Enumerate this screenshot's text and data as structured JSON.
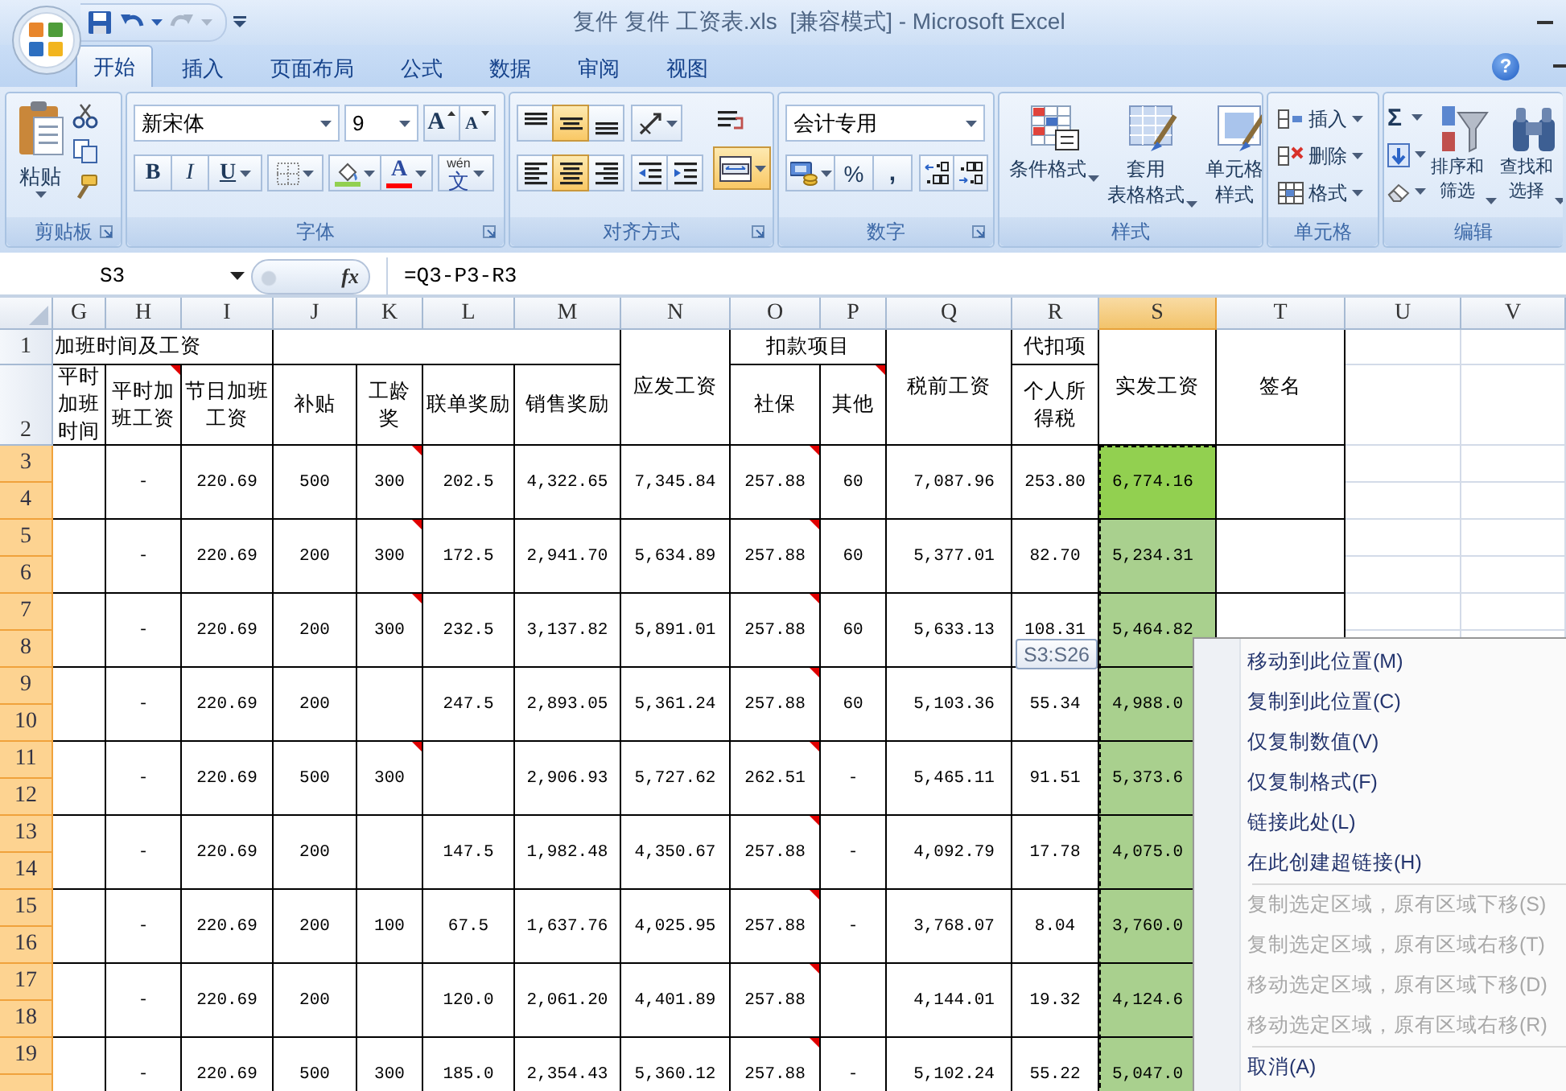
{
  "title_bar": {
    "title": "复件 复件 工资表.xls  [兼容模式] - Microsoft Excel",
    "quick_access": [
      {
        "kind": "save",
        "disabled": false
      },
      {
        "kind": "undo",
        "disabled": false
      },
      {
        "kind": "redo",
        "disabled": true
      }
    ]
  },
  "tabs": [
    {
      "label": "开始",
      "selected": true
    },
    {
      "label": "插入",
      "selected": false
    },
    {
      "label": "页面布局",
      "selected": false
    },
    {
      "label": "公式",
      "selected": false
    },
    {
      "label": "数据",
      "selected": false
    },
    {
      "label": "审阅",
      "selected": false
    },
    {
      "label": "视图",
      "selected": false
    }
  ],
  "help": "?",
  "ribbon": {
    "clipboard": {
      "paste": "粘贴",
      "label": "剪贴板"
    },
    "font": {
      "font_name": "新宋体",
      "font_size": "9",
      "grow": "A",
      "shrink": "A",
      "styles": [
        {
          "kind": "bold",
          "label": "B"
        },
        {
          "kind": "italic",
          "label": "I"
        },
        {
          "kind": "underline",
          "label": "U"
        }
      ],
      "fill": {
        "color": "#92d050"
      },
      "font_color": {
        "label": "A",
        "color": "#ff0000"
      },
      "phonetic": {
        "ruby": "wén",
        "label": "文"
      },
      "label": "字体"
    },
    "alignment": {
      "vertical": [
        {
          "kind": "top",
          "selected": false
        },
        {
          "kind": "middle",
          "selected": true
        },
        {
          "kind": "bottom",
          "selected": false
        }
      ],
      "horizontal": [
        {
          "kind": "left",
          "selected": false
        },
        {
          "kind": "center",
          "selected": true
        },
        {
          "kind": "right",
          "selected": false
        }
      ],
      "merge_selected": true,
      "label": "对齐方式"
    },
    "number": {
      "format": "会计专用",
      "percent": "%",
      "comma": ",",
      "label": "数字"
    },
    "styles": {
      "buttons": [
        {
          "kind": "conditional",
          "lines": [
            "条件格式"
          ]
        },
        {
          "kind": "table",
          "lines": [
            "套用",
            "表格格式"
          ]
        },
        {
          "kind": "cell",
          "lines": [
            "单元格",
            "样式"
          ]
        }
      ],
      "label": "样式"
    },
    "cells": {
      "buttons": [
        {
          "kind": "insert",
          "label": "插入"
        },
        {
          "kind": "delete",
          "label": "删除"
        },
        {
          "kind": "format",
          "label": "格式"
        }
      ],
      "label": "单元格"
    },
    "editing": {
      "autosum": "Σ",
      "buttons": [
        {
          "kind": "sort",
          "lines": [
            "排序和",
            "筛选"
          ]
        },
        {
          "kind": "find",
          "lines": [
            "查找和",
            "选择"
          ]
        }
      ],
      "label": "编辑"
    }
  },
  "formula_bar": {
    "name_box": "S3",
    "function_button": "fx",
    "formula": "=Q3-P3-R3"
  },
  "sheet": {
    "columns": [
      {
        "letter": "G",
        "selected": false
      },
      {
        "letter": "H",
        "selected": false
      },
      {
        "letter": "I",
        "selected": false
      },
      {
        "letter": "J",
        "selected": false
      },
      {
        "letter": "K",
        "selected": false
      },
      {
        "letter": "L",
        "selected": false
      },
      {
        "letter": "M",
        "selected": false
      },
      {
        "letter": "N",
        "selected": false
      },
      {
        "letter": "O",
        "selected": false
      },
      {
        "letter": "P",
        "selected": false
      },
      {
        "letter": "Q",
        "selected": false
      },
      {
        "letter": "R",
        "selected": false
      },
      {
        "letter": "S",
        "selected": true
      },
      {
        "letter": "T",
        "selected": false
      },
      {
        "letter": "U",
        "selected": false
      },
      {
        "letter": "V",
        "selected": false
      }
    ],
    "row_numbers": [
      {
        "label": "1",
        "selected": false
      },
      {
        "label": "2",
        "selected": false
      },
      {
        "label": "3",
        "selected": true
      },
      {
        "label": "4",
        "selected": true
      },
      {
        "label": "5",
        "selected": true
      },
      {
        "label": "6",
        "selected": true
      },
      {
        "label": "7",
        "selected": true
      },
      {
        "label": "8",
        "selected": true
      },
      {
        "label": "9",
        "selected": true
      },
      {
        "label": "10",
        "selected": true
      },
      {
        "label": "11",
        "selected": true
      },
      {
        "label": "12",
        "selected": true
      },
      {
        "label": "13",
        "selected": true
      },
      {
        "label": "14",
        "selected": true
      },
      {
        "label": "15",
        "selected": true
      },
      {
        "label": "16",
        "selected": true
      },
      {
        "label": "17",
        "selected": true
      },
      {
        "label": "18",
        "selected": true
      },
      {
        "label": "19",
        "selected": true
      },
      {
        "selected": true
      }
    ],
    "title_row": [
      {
        "text": "加班时间及工资"
      },
      {
        "text": "应发工资"
      },
      {
        "text": "扣款项目"
      },
      {
        "text": "税前工资"
      },
      {
        "text": "代扣项"
      },
      {
        "text": "实发工资"
      },
      {
        "text": "签名"
      }
    ],
    "header_row": [
      {
        "text": "平时加班时间",
        "comment": false
      },
      {
        "text": "平时加班工资",
        "comment": true
      },
      {
        "text": "节日加班工资",
        "comment": false
      },
      {
        "text": "补贴",
        "comment": false
      },
      {
        "text": "工龄奖",
        "comment": false
      },
      {
        "text": "联单奖励",
        "comment": false
      },
      {
        "text": "销售奖励",
        "comment": false
      },
      {
        "text": "社保",
        "comment": false
      },
      {
        "text": "其他",
        "comment": true
      },
      {
        "text": "个人所得税",
        "comment": false
      }
    ],
    "rows": [
      {
        "cells": [
          {
            "text": ""
          },
          {
            "text": "-"
          },
          {
            "text": "220.69"
          },
          {
            "text": "500"
          },
          {
            "text": "300",
            "comment": true
          },
          {
            "text": "202.5"
          },
          {
            "text": "4,322.65"
          },
          {
            "text": "7,345.84"
          },
          {
            "text": "257.88",
            "comment": true
          },
          {
            "text": "60"
          },
          {
            "text": "7,087.96"
          },
          {
            "text": "253.80"
          },
          {
            "text": "6,774.16",
            "color": "#92d050"
          },
          {
            "text": ""
          }
        ]
      },
      {
        "cells": [
          {
            "text": ""
          },
          {
            "text": "-"
          },
          {
            "text": "220.69"
          },
          {
            "text": "200"
          },
          {
            "text": "300",
            "comment": true
          },
          {
            "text": "172.5"
          },
          {
            "text": "2,941.70"
          },
          {
            "text": "5,634.89"
          },
          {
            "text": "257.88",
            "comment": true
          },
          {
            "text": "60"
          },
          {
            "text": "5,377.01"
          },
          {
            "text": "82.70"
          },
          {
            "text": "5,234.31",
            "color": "#a9d08e"
          },
          {
            "text": ""
          }
        ]
      },
      {
        "cells": [
          {
            "text": ""
          },
          {
            "text": "-"
          },
          {
            "text": "220.69"
          },
          {
            "text": "200"
          },
          {
            "text": "300",
            "comment": true
          },
          {
            "text": "232.5"
          },
          {
            "text": "3,137.82"
          },
          {
            "text": "5,891.01"
          },
          {
            "text": "257.88",
            "comment": true
          },
          {
            "text": "60"
          },
          {
            "text": "5,633.13"
          },
          {
            "text": "108.31"
          },
          {
            "text": "5,464.82",
            "color": "#a9d08e"
          },
          {
            "text": ""
          }
        ]
      },
      {
        "cells": [
          {
            "text": ""
          },
          {
            "text": "-"
          },
          {
            "text": "220.69"
          },
          {
            "text": "200"
          },
          {
            "text": ""
          },
          {
            "text": "247.5"
          },
          {
            "text": "2,893.05"
          },
          {
            "text": "5,361.24"
          },
          {
            "text": "257.88",
            "comment": true
          },
          {
            "text": "60"
          },
          {
            "text": "5,103.36"
          },
          {
            "text": "55.34"
          },
          {
            "text": "4,988.0",
            "color": "#a9d08e"
          }
        ]
      },
      {
        "cells": [
          {
            "text": ""
          },
          {
            "text": "-"
          },
          {
            "text": "220.69"
          },
          {
            "text": "500"
          },
          {
            "text": "300",
            "comment": true
          },
          {
            "text": ""
          },
          {
            "text": "2,906.93"
          },
          {
            "text": "5,727.62"
          },
          {
            "text": "262.51",
            "comment": true
          },
          {
            "text": "-"
          },
          {
            "text": "5,465.11"
          },
          {
            "text": "91.51"
          },
          {
            "text": "5,373.6",
            "color": "#a9d08e"
          }
        ]
      },
      {
        "cells": [
          {
            "text": ""
          },
          {
            "text": "-"
          },
          {
            "text": "220.69"
          },
          {
            "text": "200"
          },
          {
            "text": ""
          },
          {
            "text": "147.5"
          },
          {
            "text": "1,982.48"
          },
          {
            "text": "4,350.67"
          },
          {
            "text": "257.88",
            "comment": true
          },
          {
            "text": "-"
          },
          {
            "text": "4,092.79"
          },
          {
            "text": "17.78"
          },
          {
            "text": "4,075.0",
            "color": "#a9d08e"
          }
        ]
      },
      {
        "cells": [
          {
            "text": ""
          },
          {
            "text": "-"
          },
          {
            "text": "220.69"
          },
          {
            "text": "200"
          },
          {
            "text": "100"
          },
          {
            "text": "67.5"
          },
          {
            "text": "1,637.76"
          },
          {
            "text": "4,025.95"
          },
          {
            "text": "257.88",
            "comment": true
          },
          {
            "text": "-"
          },
          {
            "text": "3,768.07"
          },
          {
            "text": "8.04"
          },
          {
            "text": "3,760.0",
            "color": "#a9d08e"
          }
        ]
      },
      {
        "cells": [
          {
            "text": ""
          },
          {
            "text": "-"
          },
          {
            "text": "220.69"
          },
          {
            "text": "200"
          },
          {
            "text": ""
          },
          {
            "text": "120.0"
          },
          {
            "text": "2,061.20"
          },
          {
            "text": "4,401.89"
          },
          {
            "text": "257.88",
            "comment": true
          },
          {
            "text": ""
          },
          {
            "text": "4,144.01"
          },
          {
            "text": "19.32"
          },
          {
            "text": "4,124.6",
            "color": "#a9d08e"
          }
        ]
      },
      {
        "cells": [
          {
            "text": ""
          },
          {
            "text": "-"
          },
          {
            "text": "220.69"
          },
          {
            "text": "500"
          },
          {
            "text": "300"
          },
          {
            "text": "185.0"
          },
          {
            "text": "2,354.43"
          },
          {
            "text": "5,360.12"
          },
          {
            "text": "257.88",
            "comment": true
          },
          {
            "text": "-"
          },
          {
            "text": "5,102.24"
          },
          {
            "text": "55.22"
          },
          {
            "text": "5,047.0",
            "color": "#a9d08e"
          }
        ]
      }
    ]
  },
  "tooltip": "S3:S26",
  "context_menu": {
    "groups": [
      [
        {
          "label": "移动到此位置(M)",
          "disabled": false
        },
        {
          "label": "复制到此位置(C)",
          "disabled": false
        },
        {
          "label": "仅复制数值(V)",
          "disabled": false
        },
        {
          "label": "仅复制格式(F)",
          "disabled": false
        },
        {
          "label": "链接此处(L)",
          "disabled": false
        },
        {
          "label": "在此创建超链接(H)",
          "disabled": false
        }
      ],
      [
        {
          "label": "复制选定区域，原有区域下移(S)",
          "disabled": true
        },
        {
          "label": "复制选定区域，原有区域右移(T)",
          "disabled": true
        },
        {
          "label": "移动选定区域，原有区域下移(D)",
          "disabled": true
        },
        {
          "label": "移动选定区域，原有区域右移(R)",
          "disabled": true
        }
      ],
      [
        {
          "label": "取消(A)",
          "disabled": false
        }
      ]
    ]
  }
}
